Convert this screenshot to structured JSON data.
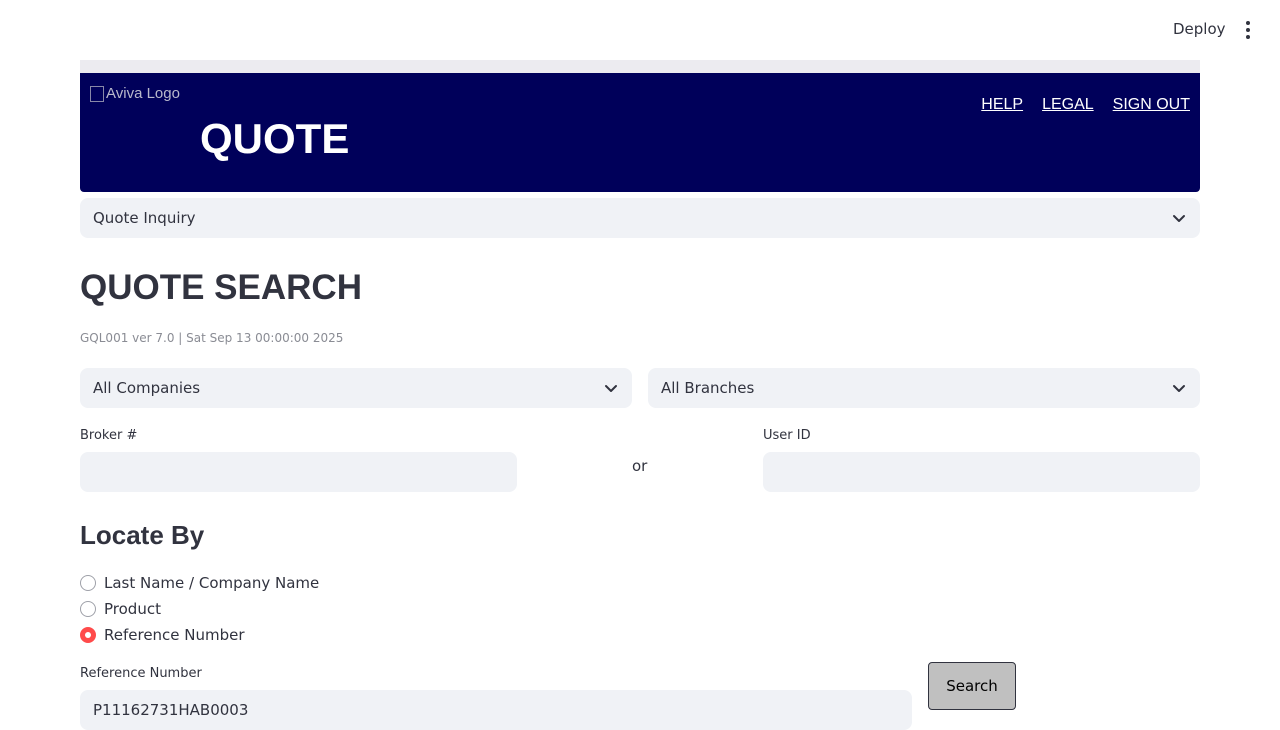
{
  "topbar": {
    "deploy_label": "Deploy",
    "menu_icon": "more-vertical-icon"
  },
  "header": {
    "logo_alt": "Aviva Logo",
    "title": "QUOTE",
    "links": [
      "HELP",
      "LEGAL",
      "SIGN OUT"
    ],
    "background_color": "#00005a"
  },
  "nav_select": {
    "value": "Quote Inquiry"
  },
  "page": {
    "title": "QUOTE SEARCH",
    "version": "GQL001 ver 7.0 | Sat Sep 13 00:00:00 2025"
  },
  "filters": {
    "company": "All Companies",
    "branch": "All Branches"
  },
  "broker": {
    "label": "Broker #",
    "value": ""
  },
  "or_text": "or",
  "user": {
    "label": "User ID",
    "value": ""
  },
  "locate": {
    "title": "Locate By",
    "options": [
      "Last Name / Company Name",
      "Product",
      "Reference Number"
    ],
    "selected": "Reference Number",
    "accent_color": "#ff4b4b"
  },
  "reference": {
    "label": "Reference Number",
    "value": "P11162731HAB0003"
  },
  "search_button": "Search"
}
